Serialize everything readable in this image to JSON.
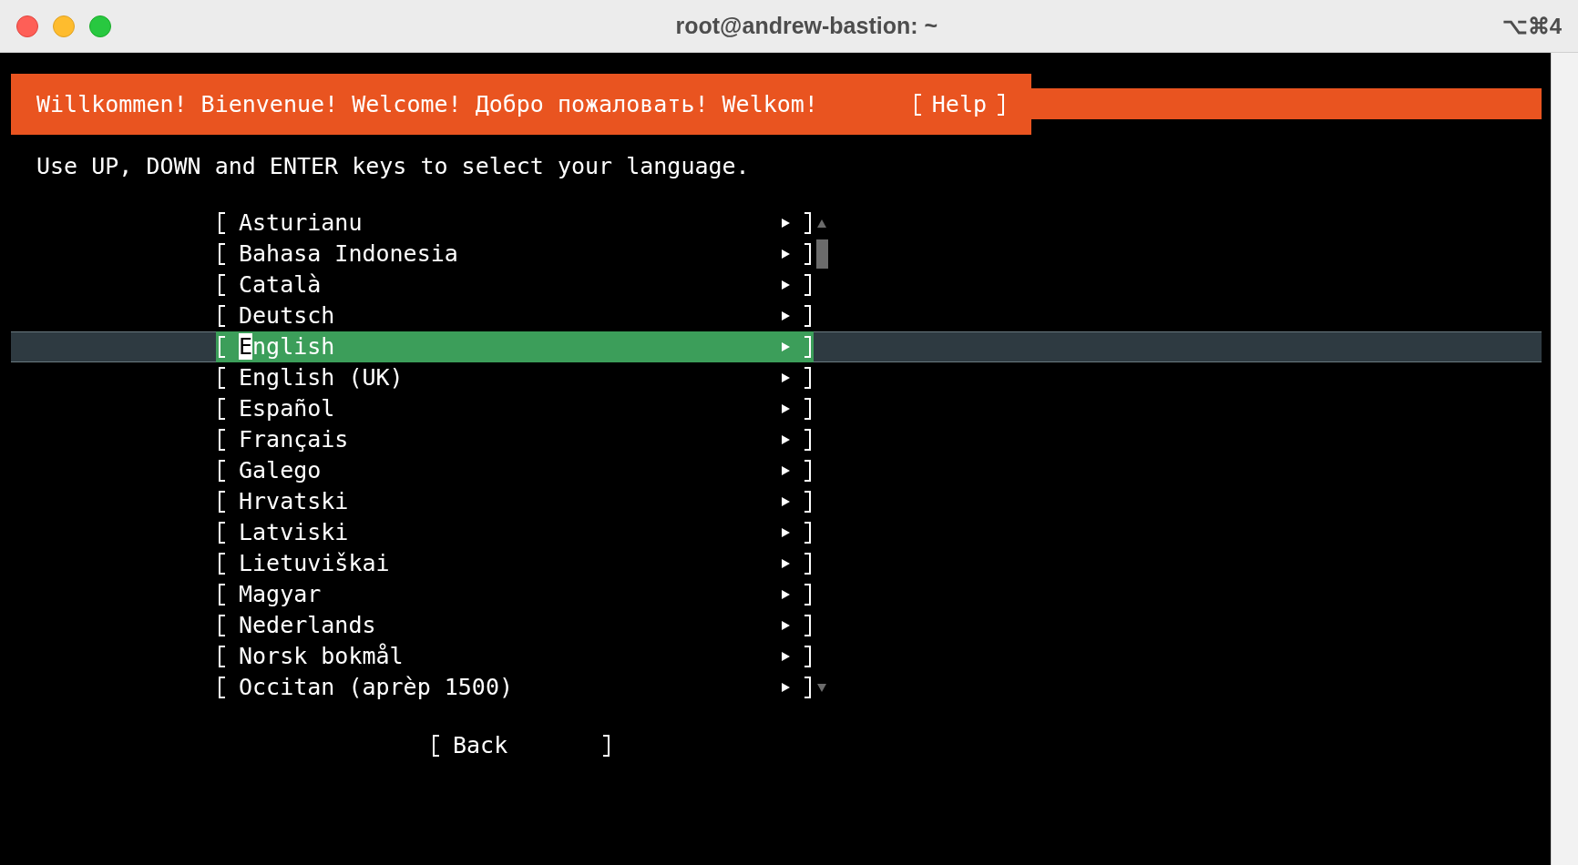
{
  "window": {
    "title": "root@andrew-bastion: ~",
    "shortcut": "⌥⌘4"
  },
  "header": {
    "title": "Willkommen! Bienvenue! Welcome! Добро пожаловать! Welkom!",
    "help_button": "Help"
  },
  "instructions": "Use UP, DOWN and ENTER keys to select your language.",
  "languages": [
    {
      "label": "Asturianu",
      "selected": false
    },
    {
      "label": "Bahasa Indonesia",
      "selected": false
    },
    {
      "label": "Català",
      "selected": false
    },
    {
      "label": "Deutsch",
      "selected": false
    },
    {
      "label": "English",
      "selected": true
    },
    {
      "label": "English (UK)",
      "selected": false
    },
    {
      "label": "Español",
      "selected": false
    },
    {
      "label": "Français",
      "selected": false
    },
    {
      "label": "Galego",
      "selected": false
    },
    {
      "label": "Hrvatski",
      "selected": false
    },
    {
      "label": "Latviski",
      "selected": false
    },
    {
      "label": "Lietuviškai",
      "selected": false
    },
    {
      "label": "Magyar",
      "selected": false
    },
    {
      "label": "Nederlands",
      "selected": false
    },
    {
      "label": "Norsk bokmål",
      "selected": false
    },
    {
      "label": "Occitan (aprèp 1500)",
      "selected": false
    }
  ],
  "back_button": "Back"
}
